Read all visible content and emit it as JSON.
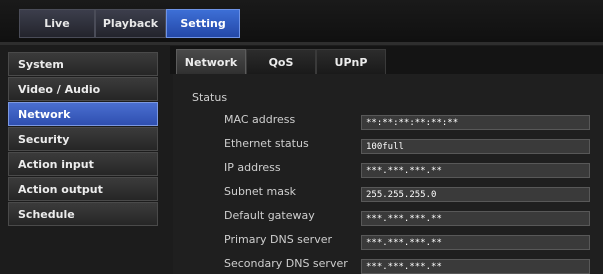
{
  "top_nav": {
    "tabs": [
      {
        "label": "Live"
      },
      {
        "label": "Playback"
      },
      {
        "label": "Setting"
      }
    ],
    "active_tab": "Setting"
  },
  "sidebar": {
    "items": [
      {
        "label": "System"
      },
      {
        "label": "Video / Audio"
      },
      {
        "label": "Network"
      },
      {
        "label": "Security"
      },
      {
        "label": "Action input"
      },
      {
        "label": "Action output"
      },
      {
        "label": "Schedule"
      }
    ],
    "active_item": "Network"
  },
  "sub_tabs": {
    "tabs": [
      {
        "label": "Network"
      },
      {
        "label": "QoS"
      },
      {
        "label": "UPnP"
      }
    ],
    "active_tab": "Network"
  },
  "status": {
    "section_title": "Status",
    "rows": [
      {
        "label": "MAC address",
        "value": "**:**:**:**:**:**"
      },
      {
        "label": "Ethernet status",
        "value": "100full"
      },
      {
        "label": "IP address",
        "value": "***.***.***.**"
      },
      {
        "label": "Subnet mask",
        "value": "255.255.255.0"
      },
      {
        "label": "Default gateway",
        "value": "***.***.***.**"
      },
      {
        "label": "Primary DNS server",
        "value": "***.***.***.**"
      },
      {
        "label": "Secondary DNS server",
        "value": "***.***.***.**"
      }
    ]
  },
  "colors": {
    "active_blue": "#3d6fd6",
    "panel_bg": "#1f1f1f",
    "field_bg": "#3a3a3a"
  }
}
